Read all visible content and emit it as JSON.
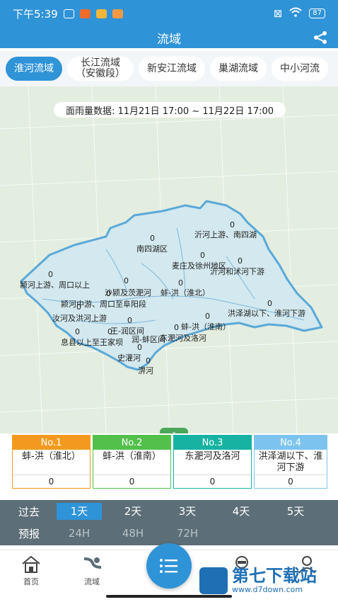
{
  "status_bar": {
    "time": "下午5:39",
    "battery": "87"
  },
  "header": {
    "title": "流域"
  },
  "tabs": [
    {
      "label": "淮河流域",
      "sub": "",
      "active": true
    },
    {
      "label": "长江流域",
      "sub": "（安徽段）",
      "active": false
    },
    {
      "label": "新安江流域",
      "sub": "",
      "active": false
    },
    {
      "label": "巢湖流域",
      "sub": "",
      "active": false
    },
    {
      "label": "中小河流",
      "sub": "",
      "active": false
    }
  ],
  "map": {
    "time_range": "面雨量数据: 11月21日 17:00 ~ 11月22日 17:00",
    "regions": [
      {
        "name": "沂河上游、南四湖",
        "value": "0"
      },
      {
        "name": "南四湖区",
        "value": "0"
      },
      {
        "name": "麦庄及徐州地区",
        "value": "0"
      },
      {
        "name": "沂河和沭河下游",
        "value": "0"
      },
      {
        "name": "颍河上游、周口以上",
        "value": "0"
      },
      {
        "name": "沙颍及茨淝河",
        "value": "0"
      },
      {
        "name": "蚌-洪（淮北）",
        "value": "0"
      },
      {
        "name": "颍河中游、周口至阜阳段",
        "value": "0"
      },
      {
        "name": "洪泽湖以下、淮河下游",
        "value": "0"
      },
      {
        "name": "汝河及洪河上游",
        "value": "0"
      },
      {
        "name": "王-润区间",
        "value": "0"
      },
      {
        "name": "蚌-洪（淮南）",
        "value": "0"
      },
      {
        "name": "息县以上至王家坝",
        "value": "0"
      },
      {
        "name": "润-蚌区间",
        "value": "0"
      },
      {
        "name": "东淝河及洛河",
        "value": "0"
      },
      {
        "name": "史灌河",
        "value": "0"
      },
      {
        "name": "淠河",
        "value": "0"
      }
    ]
  },
  "ranking": [
    {
      "rank": "No.1",
      "name": "蚌-洪（淮北）",
      "value": "0",
      "color": "#f39a1e"
    },
    {
      "rank": "No.2",
      "name": "蚌-洪（淮南）",
      "value": "0",
      "color": "#52c04a"
    },
    {
      "rank": "No.3",
      "name": "东淝河及洛河",
      "value": "0",
      "color": "#16b3a2"
    },
    {
      "rank": "No.4",
      "name": "洪泽湖以下、淮河下游",
      "value": "0",
      "color": "#7cc4ef"
    }
  ],
  "time_bar": {
    "past_label": "过去",
    "forecast_label": "预报",
    "past": [
      "1天",
      "2天",
      "3天",
      "4天",
      "5天"
    ],
    "forecast": [
      "24H",
      "48H",
      "72H"
    ],
    "selected": "1天"
  },
  "bottom_nav": {
    "home": "首页",
    "basin": "流域",
    "item4": "",
    "item5": ""
  },
  "watermark": {
    "title": "第七下载站",
    "url": "www.d7down.com"
  },
  "colors": {
    "primary": "#2f93d8",
    "map_bg": "#e3ede0",
    "basin_fill": "#d3e8ef",
    "basin_border": "#5aa9d8",
    "time_bar": "#5c6e78"
  }
}
